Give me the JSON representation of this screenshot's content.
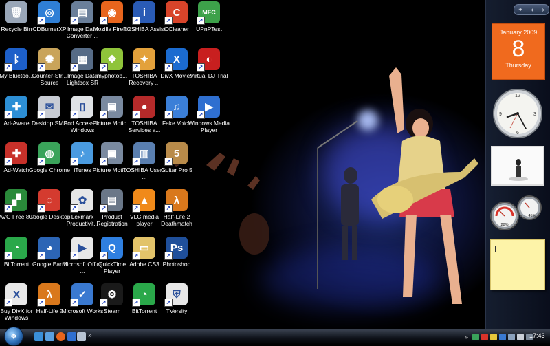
{
  "desktop": {
    "icons": [
      {
        "label": "Recycle Bin",
        "icon": "recycle-bin-icon",
        "color": "#9aa7b8",
        "glyph": "🗑"
      },
      {
        "label": "CDBurnerXP",
        "icon": "cdburnerxp-icon",
        "color": "#2f7fd6",
        "glyph": "◎"
      },
      {
        "label": "Image Data Converter ...",
        "icon": "image-data-converter-icon",
        "color": "#6a7f9a",
        "glyph": "▤"
      },
      {
        "label": "Mozilla Firefox",
        "icon": "firefox-icon",
        "color": "#e8651d",
        "glyph": "◉"
      },
      {
        "label": "TOSHIBA Assist",
        "icon": "toshiba-assist-icon",
        "color": "#2a5bb5",
        "glyph": "i"
      },
      {
        "label": "CCleaner",
        "icon": "ccleaner-icon",
        "color": "#d8442a",
        "glyph": "C"
      },
      {
        "label": "UPnPTest",
        "icon": "upnptest-icon",
        "color": "#3da14a",
        "glyph": "MFC"
      },
      {
        "label": "My Bluetoo...",
        "icon": "bluetooth-icon",
        "color": "#1d5fc9",
        "glyph": "ᛒ"
      },
      {
        "label": "Counter-Str... Source",
        "icon": "counter-strike-icon",
        "color": "#c9a45a",
        "glyph": "✺"
      },
      {
        "label": "Image Data Lightbox SR",
        "icon": "image-data-lightbox-icon",
        "color": "#566b86",
        "glyph": "▦"
      },
      {
        "label": "myphotob...",
        "icon": "myphotobook-icon",
        "color": "#8fc43a",
        "glyph": "❖"
      },
      {
        "label": "TOSHIBA Recovery ...",
        "icon": "toshiba-recovery-icon",
        "color": "#e3a13b",
        "glyph": "✦"
      },
      {
        "label": "DivX Movies",
        "icon": "divx-movies-icon",
        "color": "#1b6bd0",
        "glyph": "X"
      },
      {
        "label": "Virtual DJ Trial",
        "icon": "virtual-dj-icon",
        "color": "#c81f1f",
        "glyph": "◐"
      },
      {
        "label": "Ad-Aware",
        "icon": "ad-aware-icon",
        "color": "#2d8fd5",
        "glyph": "✚"
      },
      {
        "label": "Desktop SMS",
        "icon": "desktop-sms-icon",
        "color": "#c8ccd4",
        "glyph": "✉"
      },
      {
        "label": "iPod Access for Windows",
        "icon": "ipod-access-icon",
        "color": "#dfe2e6",
        "glyph": "▯"
      },
      {
        "label": "Picture Motio...",
        "icon": "picture-motion-icon",
        "color": "#7a8aa0",
        "glyph": "▣"
      },
      {
        "label": "TOSHIBA Services a...",
        "icon": "toshiba-services-icon",
        "color": "#b52a2a",
        "glyph": "●"
      },
      {
        "label": "Fake Voice",
        "icon": "fake-voice-icon",
        "color": "#3b7fd8",
        "glyph": "♫"
      },
      {
        "label": "Windows Media Player",
        "icon": "windows-media-player-icon",
        "color": "#2f6fd0",
        "glyph": "▶"
      },
      {
        "label": "Ad-Watch",
        "icon": "ad-watch-icon",
        "color": "#c8312a",
        "glyph": "✚"
      },
      {
        "label": "Google Chrome",
        "icon": "chrome-icon",
        "color": "#3aa35a",
        "glyph": "◍"
      },
      {
        "label": "iTunes",
        "icon": "itunes-icon",
        "color": "#4a9be0",
        "glyph": "♪"
      },
      {
        "label": "Picture Motio...",
        "icon": "picture-motion-icon",
        "color": "#7a8aa0",
        "glyph": "▣"
      },
      {
        "label": "TOSHIBA User's ...",
        "icon": "toshiba-users-guide-icon",
        "color": "#5a7fb0",
        "glyph": "▥"
      },
      {
        "label": "Guitar Pro 5",
        "icon": "guitar-pro-icon",
        "color": "#b98b4a",
        "glyph": "5"
      },
      {
        "label": "AVG Free 8.0",
        "icon": "avg-icon",
        "color": "#2a8a3a",
        "glyph": "▞"
      },
      {
        "label": "Google Desktop",
        "icon": "google-desktop-icon",
        "color": "#d43b2f",
        "glyph": "◌"
      },
      {
        "label": "Lexmark Productivit...",
        "icon": "lexmark-icon",
        "color": "#e6e6e6",
        "glyph": "✿"
      },
      {
        "label": "Product Registration",
        "icon": "product-registration-icon",
        "color": "#6a7788",
        "glyph": "▤"
      },
      {
        "label": "VLC media player",
        "icon": "vlc-icon",
        "color": "#f08a1a",
        "glyph": "▲"
      },
      {
        "label": "Half-Life 2 Deathmatch",
        "icon": "half-life-2-deathmatch-icon",
        "color": "#d9781c",
        "glyph": "λ"
      },
      {
        "label": "BitTorrent",
        "icon": "bittorrent-icon",
        "color": "#2aa84a",
        "glyph": "◔"
      },
      {
        "label": "Google Earth",
        "icon": "google-earth-icon",
        "color": "#2c65b5",
        "glyph": "◕"
      },
      {
        "label": "Microsoft Office ...",
        "icon": "microsoft-office-icon",
        "color": "#e8e8e8",
        "glyph": "▶"
      },
      {
        "label": "QuickTime Player",
        "icon": "quicktime-icon",
        "color": "#2f7fe0",
        "glyph": "Q"
      },
      {
        "label": "Adobe CS3",
        "icon": "adobe-cs3-folder-icon",
        "color": "#e2c36a",
        "glyph": "▭"
      },
      {
        "label": "Photoshop",
        "icon": "photoshop-icon",
        "color": "#1f4f9a",
        "glyph": "Ps"
      },
      {
        "label": "Buy DivX for Windows",
        "icon": "buy-divx-icon",
        "color": "#e8e8e8",
        "glyph": "X"
      },
      {
        "label": "Half-Life 2",
        "icon": "half-life-2-icon",
        "color": "#d9781c",
        "glyph": "λ"
      },
      {
        "label": "Microsoft Works",
        "icon": "microsoft-works-icon",
        "color": "#3a79d0",
        "glyph": "✓"
      },
      {
        "label": "Steam",
        "icon": "steam-icon",
        "color": "#1a1a1a",
        "glyph": "⚙"
      },
      {
        "label": "BitTorrent",
        "icon": "bittorrent-icon",
        "color": "#2aa84a",
        "glyph": "◔"
      },
      {
        "label": "TVersity",
        "icon": "tversity-icon",
        "color": "#e8e8e8",
        "glyph": "⛨"
      }
    ]
  },
  "sidebar": {
    "controls": {
      "add": "+",
      "prev": "‹",
      "next": "›"
    },
    "calendar": {
      "month_year": "January 2009",
      "day": "8",
      "weekday": "Thursday"
    },
    "meters": {
      "cpu": "28%",
      "memory": "45%"
    }
  },
  "taskbar": {
    "start_glyph": "❖",
    "more": "»",
    "tray_more": "»",
    "clock": "17:43",
    "colors": {
      "accent": "#2d6fb8"
    }
  }
}
